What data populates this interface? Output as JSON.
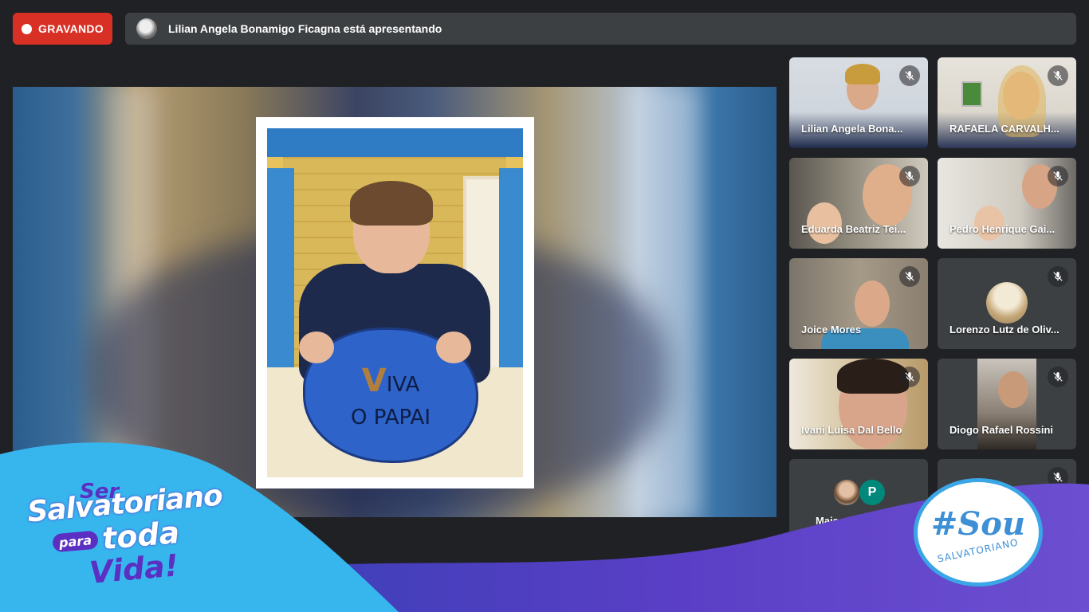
{
  "recording": {
    "label": "GRAVANDO",
    "color": "#d93025"
  },
  "presenter_bar": {
    "text": "Lilian Angela Bonamigo Ficagna está apresentando"
  },
  "presentation": {
    "sign_line1_initial": "V",
    "sign_line1_rest": "IVA",
    "sign_line2": "O PAPAI"
  },
  "participants": [
    {
      "name": "Lilian Angela Bona...",
      "mic": "mic-off-icon"
    },
    {
      "name": "RAFAELA CARVALH...",
      "mic": "mic-off-icon"
    },
    {
      "name": "Eduarda Beatriz Tei...",
      "mic": "mic-off-icon"
    },
    {
      "name": "Pedro Henrique Gai...",
      "mic": "mic-off-icon"
    },
    {
      "name": "Joice Mores",
      "mic": "mic-off-icon"
    },
    {
      "name": "Lorenzo Lutz de Oliv...",
      "mic": "mic-off-icon"
    },
    {
      "name": "Ivani Luisa Dal Bello",
      "mic": "mic-off-icon"
    },
    {
      "name": "Diogo Rafael Rossini",
      "mic": "mic-off-icon"
    },
    {
      "name": "Mais",
      "avatar_letter": "P"
    },
    {
      "name": "",
      "mic": "mic-off-icon"
    }
  ],
  "branding": {
    "left_ser": "Ser",
    "left_salvatoriano": "Salvatoriano",
    "left_para": "para",
    "left_toda": "toda",
    "left_vida": "Vida!",
    "badge_sou": "#Sou",
    "badge_salvatoriano": "SALVATORIANO"
  },
  "colors": {
    "brand_blue": "#37b6ee",
    "brand_purple": "#5b2fc2"
  }
}
